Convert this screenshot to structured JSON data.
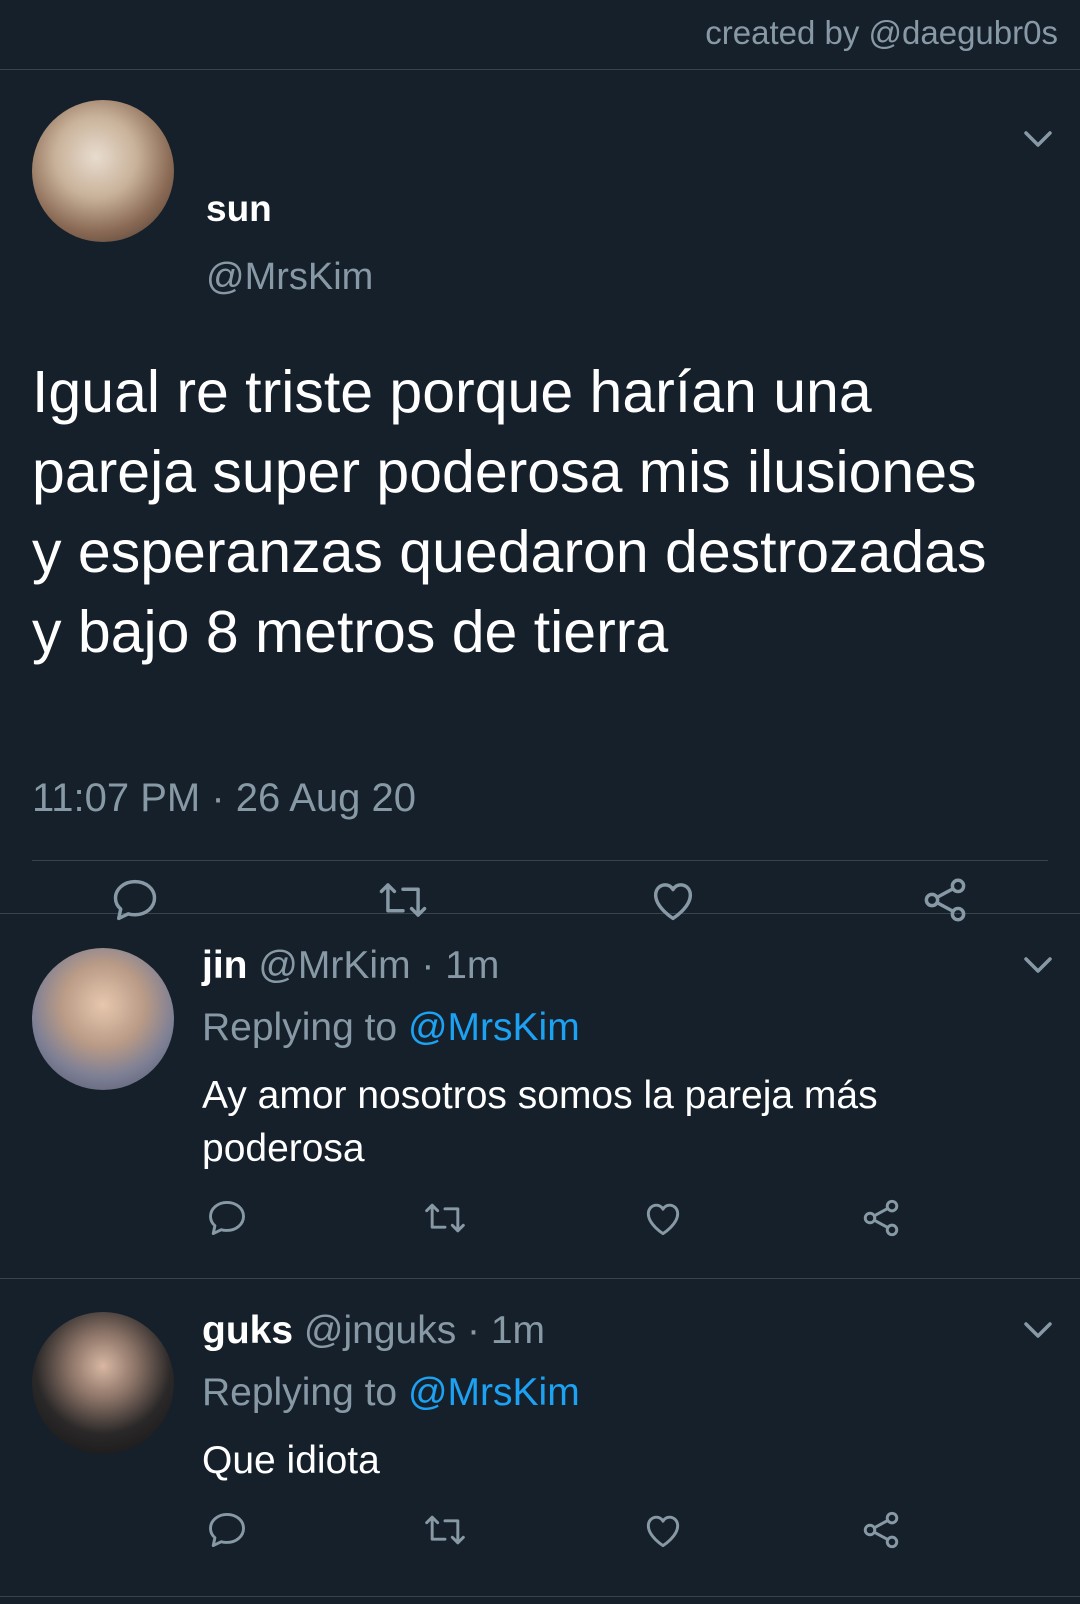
{
  "credit": "created by @daegubr0s",
  "main_tweet": {
    "display_name": "sun",
    "handle": "@MrsKim",
    "text": "Igual re triste porque harían una pareja super poderosa mis ilusiones y esperanzas quedaron destrozadas y bajo 8 metros de tierra",
    "timestamp": "11:07 PM · 26 Aug 20"
  },
  "replies": [
    {
      "display_name": "jin",
      "handle": "@MrKim",
      "time": "· 1m",
      "replying_label": "Replying to",
      "replying_to": "@MrsKim",
      "text": "Ay amor nosotros somos la pareja más poderosa"
    },
    {
      "display_name": "guks",
      "handle": "@jnguks",
      "time": "· 1m",
      "replying_label": "Replying to",
      "replying_to": "@MrsKim",
      "text": "Que idiota"
    }
  ],
  "icons": {
    "reply": "comment-icon",
    "retweet": "retweet-icon",
    "like": "heart-icon",
    "share": "share-icon",
    "menu": "chevron-down-icon"
  },
  "colors": {
    "background": "#15202b",
    "secondary_text": "#8899a6",
    "link": "#1da1f2",
    "divider": "#38444d"
  }
}
